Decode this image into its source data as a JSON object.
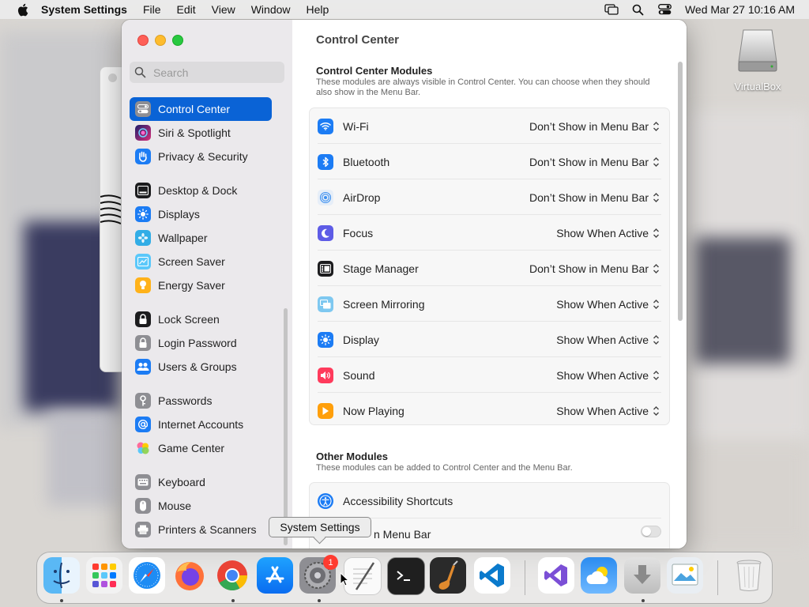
{
  "menubar": {
    "app_name": "System Settings",
    "menus": [
      "File",
      "Edit",
      "View",
      "Window",
      "Help"
    ],
    "datetime": "Wed Mar 27  10:16 AM"
  },
  "desktop": {
    "icon_label": "VirtualBox"
  },
  "sidebar": {
    "search_placeholder": "Search",
    "items": [
      {
        "label": "Control Center",
        "icon": "control-center-icon",
        "color": "#8e8e93",
        "selected": true
      },
      {
        "label": "Siri & Spotlight",
        "icon": "siri-icon",
        "color": "#7b3fe4"
      },
      {
        "label": "Privacy & Security",
        "icon": "hand-icon",
        "color": "#1c7cf4"
      },
      {
        "label": "Desktop & Dock",
        "icon": "dock-icon",
        "color": "#1c1c1e"
      },
      {
        "label": "Displays",
        "icon": "sun-icon",
        "color": "#1c7cf4"
      },
      {
        "label": "Wallpaper",
        "icon": "flower-icon",
        "color": "#32ade6"
      },
      {
        "label": "Screen Saver",
        "icon": "screensaver-icon",
        "color": "#5ac8fa"
      },
      {
        "label": "Energy Saver",
        "icon": "bulb-icon",
        "color": "#ffb21a"
      },
      {
        "label": "Lock Screen",
        "icon": "lock-icon",
        "color": "#1c1c1e"
      },
      {
        "label": "Login Password",
        "icon": "lock-icon",
        "color": "#8e8e93"
      },
      {
        "label": "Users & Groups",
        "icon": "users-icon",
        "color": "#1c7cf4"
      },
      {
        "label": "Passwords",
        "icon": "key-icon",
        "color": "#8e8e93"
      },
      {
        "label": "Internet Accounts",
        "icon": "at-icon",
        "color": "#1c7cf4"
      },
      {
        "label": "Game Center",
        "icon": "game-center-icon",
        "color": "#ff6b9a"
      },
      {
        "label": "Keyboard",
        "icon": "keyboard-icon",
        "color": "#8e8e93"
      },
      {
        "label": "Mouse",
        "icon": "mouse-icon",
        "color": "#8e8e93"
      },
      {
        "label": "Printers & Scanners",
        "icon": "printer-icon",
        "color": "#8e8e93"
      }
    ]
  },
  "content": {
    "title": "Control Center",
    "modules_title": "Control Center Modules",
    "modules_desc": "These modules are always visible in Control Center. You can choose when they should also show in the Menu Bar.",
    "modules": [
      {
        "label": "Wi-Fi",
        "value": "Don’t Show in Menu Bar",
        "icon": "wifi-icon",
        "color": "#1c7cf4"
      },
      {
        "label": "Bluetooth",
        "value": "Don’t Show in Menu Bar",
        "icon": "bluetooth-icon",
        "color": "#1c7cf4"
      },
      {
        "label": "AirDrop",
        "value": "Don’t Show in Menu Bar",
        "icon": "airdrop-icon",
        "color": "#e6eef8"
      },
      {
        "label": "Focus",
        "value": "Show When Active",
        "icon": "moon-icon",
        "color": "#5e5ce6"
      },
      {
        "label": "Stage Manager",
        "value": "Don’t Show in Menu Bar",
        "icon": "stage-manager-icon",
        "color": "#1c1c1e"
      },
      {
        "label": "Screen Mirroring",
        "value": "Show When Active",
        "icon": "screen-mirroring-icon",
        "color": "#7ec8f0"
      },
      {
        "label": "Display",
        "value": "Show When Active",
        "icon": "sun-icon",
        "color": "#1c7cf4"
      },
      {
        "label": "Sound",
        "value": "Show When Active",
        "icon": "speaker-icon",
        "color": "#ff3b5c"
      },
      {
        "label": "Now Playing",
        "value": "Show When Active",
        "icon": "play-icon",
        "color": "#ff9f0a"
      }
    ],
    "other_title": "Other Modules",
    "other_desc": "These modules can be added to Control Center and the Menu Bar.",
    "other_modules": [
      {
        "label": "Accessibility Shortcuts",
        "icon": "accessibility-icon",
        "color": "#1c7cf4"
      }
    ],
    "partial_row_label": "n Menu Bar"
  },
  "tooltip": "System Settings",
  "dock": {
    "badge_count": "1",
    "apps": [
      "finder-icon",
      "launchpad-icon",
      "safari-icon",
      "firefox-icon",
      "chrome-icon",
      "app-store-icon",
      "system-settings-icon",
      "textedit-icon",
      "terminal-icon",
      "garageband-icon",
      "vscode-icon",
      "visual-studio-icon",
      "weather-icon",
      "downloads-icon",
      "preview-icon",
      "trash-icon"
    ]
  }
}
